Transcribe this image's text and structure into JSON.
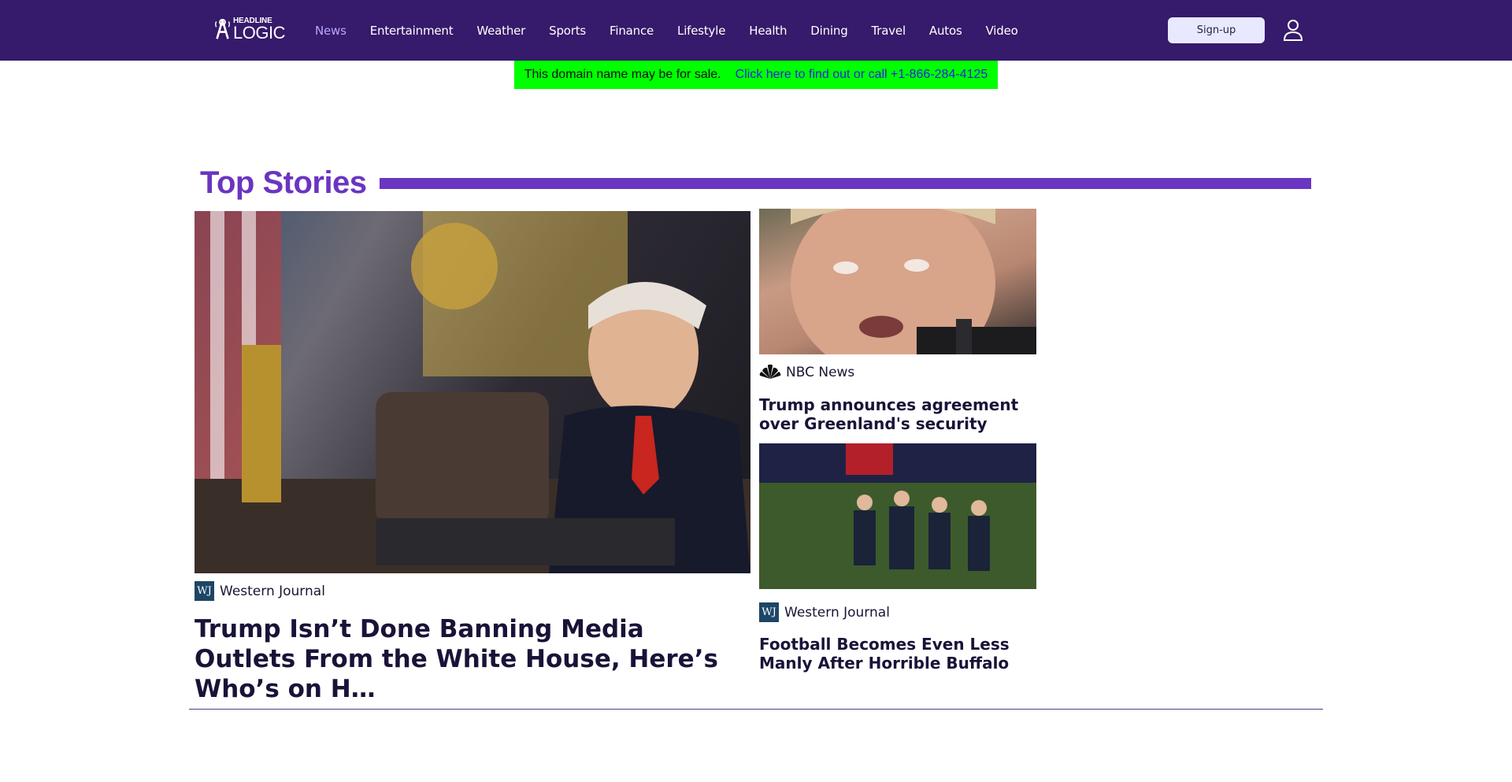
{
  "brand": {
    "top": "HEADLINE",
    "bottom": "LOGIC"
  },
  "nav": {
    "items": [
      "News",
      "Entertainment",
      "Weather",
      "Sports",
      "Finance",
      "Lifestyle",
      "Health",
      "Dining",
      "Travel",
      "Autos",
      "Video"
    ],
    "active": "News"
  },
  "header": {
    "signup_label": "Sign-up"
  },
  "sale_banner": {
    "text": "This domain name may be for sale.",
    "link": "Click here to find out or call +1-866-284-4125"
  },
  "section": {
    "title": "Top Stories"
  },
  "stories": [
    {
      "source": "Western Journal",
      "source_logo": "WJ",
      "headline": "Trump Isn’t Done Banning Media Outlets From the White House, Here’s Who’s on H…"
    },
    {
      "source": "NBC News",
      "headline": "Trump announces agreement over Greenland's security"
    },
    {
      "source": "Western Journal",
      "source_logo": "WJ",
      "headline": "Football Becomes Even Less Manly After Horrible Buffalo Bill…"
    }
  ],
  "colors": {
    "header_bg": "#361a6b",
    "accent": "#6a35c0",
    "nav_active": "#b9a6ff",
    "sale_bg": "#00ff00",
    "sale_link": "#2525d9"
  }
}
